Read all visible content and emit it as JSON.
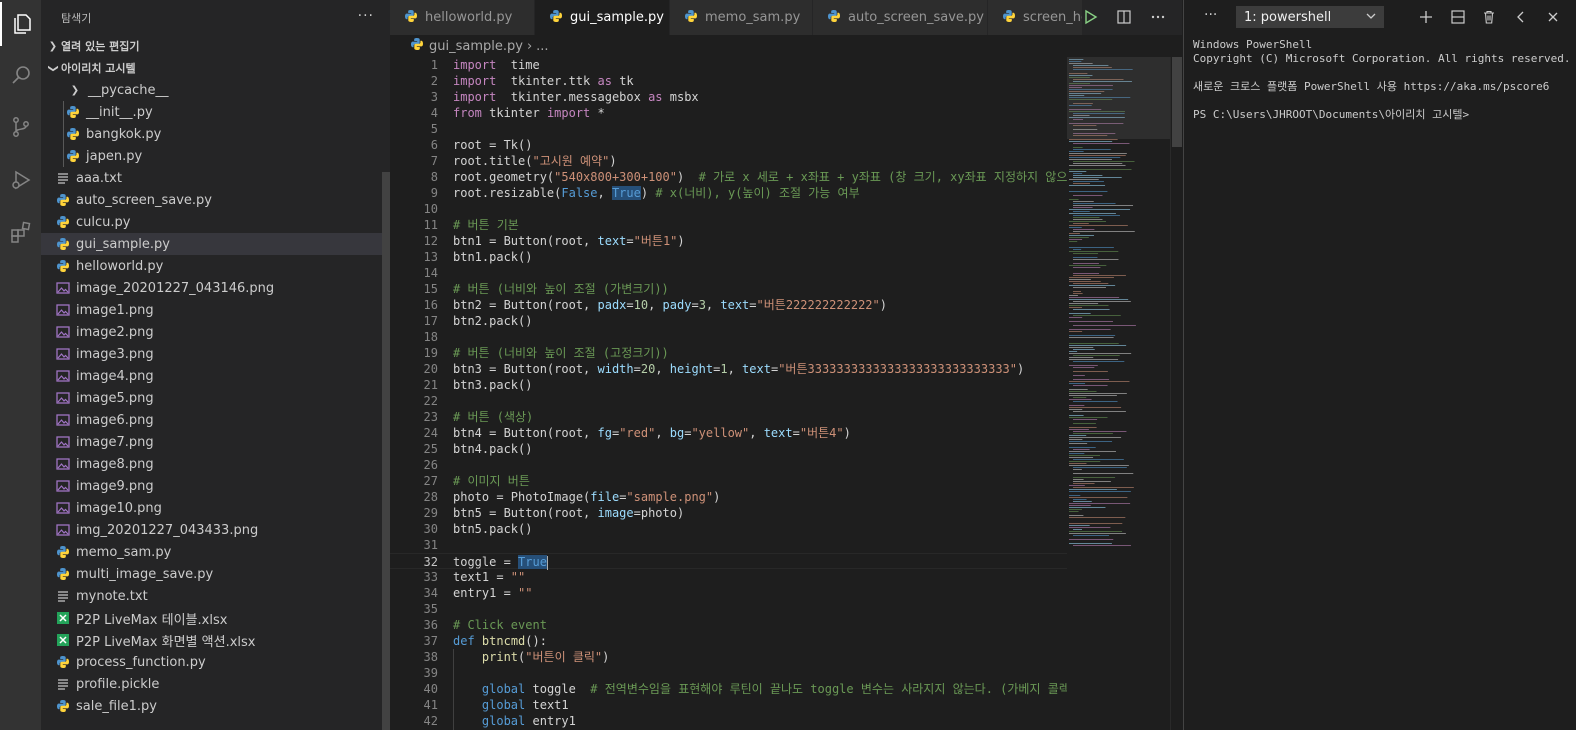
{
  "sidebar": {
    "title": "탐색기",
    "more": "···",
    "open_editors": "열려 있는 편집기",
    "folder": "아이리치 고시텔",
    "items": [
      {
        "label": "__pycache__",
        "type": "folder"
      },
      {
        "label": "__init__.py",
        "type": "py"
      },
      {
        "label": "bangkok.py",
        "type": "py"
      },
      {
        "label": "japen.py",
        "type": "py"
      },
      {
        "label": "aaa.txt",
        "type": "txt"
      },
      {
        "label": "auto_screen_save.py",
        "type": "py"
      },
      {
        "label": "culcu.py",
        "type": "py"
      },
      {
        "label": "gui_sample.py",
        "type": "py",
        "selected": true
      },
      {
        "label": "helloworld.py",
        "type": "py"
      },
      {
        "label": "image_20201227_043146.png",
        "type": "png"
      },
      {
        "label": "image1.png",
        "type": "png"
      },
      {
        "label": "image2.png",
        "type": "png"
      },
      {
        "label": "image3.png",
        "type": "png"
      },
      {
        "label": "image4.png",
        "type": "png"
      },
      {
        "label": "image5.png",
        "type": "png"
      },
      {
        "label": "image6.png",
        "type": "png"
      },
      {
        "label": "image7.png",
        "type": "png"
      },
      {
        "label": "image8.png",
        "type": "png"
      },
      {
        "label": "image9.png",
        "type": "png"
      },
      {
        "label": "image10.png",
        "type": "png"
      },
      {
        "label": "img_20201227_043433.png",
        "type": "png"
      },
      {
        "label": "memo_sam.py",
        "type": "py"
      },
      {
        "label": "multi_image_save.py",
        "type": "py"
      },
      {
        "label": "mynote.txt",
        "type": "txt"
      },
      {
        "label": "P2P LiveMax 테이블.xlsx",
        "type": "xlsx"
      },
      {
        "label": "P2P LiveMax 화면별 액션.xlsx",
        "type": "xlsx"
      },
      {
        "label": "process_function.py",
        "type": "py"
      },
      {
        "label": "profile.pickle",
        "type": "txt"
      },
      {
        "label": "sale_file1.py",
        "type": "py"
      }
    ]
  },
  "tabs": [
    {
      "label": "helloworld.py"
    },
    {
      "label": "gui_sample.py",
      "active": true,
      "close": "✕"
    },
    {
      "label": "memo_sam.py"
    },
    {
      "label": "auto_screen_save.py"
    },
    {
      "label": "screen_ho"
    }
  ],
  "breadcrumb": {
    "file": "gui_sample.py",
    "sep": "›",
    "more": "..."
  },
  "code": [
    [
      [
        "kw",
        "import"
      ],
      [
        "",
        "  time"
      ]
    ],
    [
      [
        "kw",
        "import"
      ],
      [
        "",
        "  tkinter.ttk "
      ],
      [
        "kw",
        "as"
      ],
      [
        "",
        " tk"
      ]
    ],
    [
      [
        "kw",
        "import"
      ],
      [
        "",
        "  tkinter.messagebox "
      ],
      [
        "kw",
        "as"
      ],
      [
        "",
        " msbx"
      ]
    ],
    [
      [
        "kw",
        "from"
      ],
      [
        "",
        " tkinter "
      ],
      [
        "kw",
        "import"
      ],
      [
        "",
        " *"
      ]
    ],
    [],
    [
      [
        "",
        "root = Tk()"
      ]
    ],
    [
      [
        "",
        "root.title("
      ],
      [
        "str",
        "\"고시원 예약\""
      ],
      [
        "",
        ")"
      ]
    ],
    [
      [
        "",
        "root.geometry("
      ],
      [
        "str",
        "\"540x800+300+100\""
      ],
      [
        "",
        ")  "
      ],
      [
        "cmt",
        "# 가로 x 세로 + x좌표 + y좌표 (창 크기, xy좌표 지정하지 않으면"
      ]
    ],
    [
      [
        "",
        "root.resizable("
      ],
      [
        "kw2",
        "False"
      ],
      [
        "",
        ", "
      ],
      [
        "kw2hl",
        "True"
      ],
      [
        "",
        ") "
      ],
      [
        "cmt",
        "# x(너비), y(높이) 조절 가능 여부"
      ]
    ],
    [],
    [
      [
        "cmt",
        "# 버튼 기본"
      ]
    ],
    [
      [
        "",
        "btn1 = Button(root, "
      ],
      [
        "par",
        "text"
      ],
      [
        "",
        "="
      ],
      [
        "str",
        "\"버튼1\""
      ],
      [
        "",
        ")"
      ]
    ],
    [
      [
        "",
        "btn1.pack()"
      ]
    ],
    [],
    [
      [
        "cmt",
        "# 버튼 (너비와 높이 조절 (가변크기))"
      ]
    ],
    [
      [
        "",
        "btn2 = Button(root, "
      ],
      [
        "par",
        "padx"
      ],
      [
        "",
        "="
      ],
      [
        "num",
        "10"
      ],
      [
        "",
        ", "
      ],
      [
        "par",
        "pady"
      ],
      [
        "",
        "="
      ],
      [
        "num",
        "3"
      ],
      [
        "",
        ", "
      ],
      [
        "par",
        "text"
      ],
      [
        "",
        "="
      ],
      [
        "str",
        "\"버튼222222222222\""
      ],
      [
        "",
        ")"
      ]
    ],
    [
      [
        "",
        "btn2.pack()"
      ]
    ],
    [],
    [
      [
        "cmt",
        "# 버튼 (너비와 높이 조절 (고정크기))"
      ]
    ],
    [
      [
        "",
        "btn3 = Button(root, "
      ],
      [
        "par",
        "width"
      ],
      [
        "",
        "="
      ],
      [
        "num",
        "20"
      ],
      [
        "",
        ", "
      ],
      [
        "par",
        "height"
      ],
      [
        "",
        "="
      ],
      [
        "num",
        "1"
      ],
      [
        "",
        ", "
      ],
      [
        "par",
        "text"
      ],
      [
        "",
        "="
      ],
      [
        "str",
        "\"버튼3333333333333333333333333333\""
      ],
      [
        "",
        ")"
      ]
    ],
    [
      [
        "",
        "btn3.pack()"
      ]
    ],
    [],
    [
      [
        "cmt",
        "# 버튼 (색상)"
      ]
    ],
    [
      [
        "",
        "btn4 = Button(root, "
      ],
      [
        "par",
        "fg"
      ],
      [
        "",
        "="
      ],
      [
        "str",
        "\"red\""
      ],
      [
        "",
        ", "
      ],
      [
        "par",
        "bg"
      ],
      [
        "",
        "="
      ],
      [
        "str",
        "\"yellow\""
      ],
      [
        "",
        ", "
      ],
      [
        "par",
        "text"
      ],
      [
        "",
        "="
      ],
      [
        "str",
        "\"버튼4\""
      ],
      [
        "",
        ")"
      ]
    ],
    [
      [
        "",
        "btn4.pack()"
      ]
    ],
    [],
    [
      [
        "cmt",
        "# 이미지 버튼"
      ]
    ],
    [
      [
        "",
        "photo = PhotoImage("
      ],
      [
        "par",
        "file"
      ],
      [
        "",
        "="
      ],
      [
        "str",
        "\"sample.png\""
      ],
      [
        "",
        ")"
      ]
    ],
    [
      [
        "",
        "btn5 = Button(root, "
      ],
      [
        "par",
        "image"
      ],
      [
        "",
        "=photo)"
      ]
    ],
    [
      [
        "",
        "btn5.pack()"
      ]
    ],
    [],
    [
      [
        "",
        "toggle = "
      ],
      [
        "kw2hl",
        "True"
      ],
      [
        "cursor",
        ""
      ]
    ],
    [
      [
        "",
        "text1 = "
      ],
      [
        "str",
        "\"\""
      ]
    ],
    [
      [
        "",
        "entry1 = "
      ],
      [
        "str",
        "\"\""
      ]
    ],
    [],
    [
      [
        "cmt",
        "# Click event"
      ]
    ],
    [
      [
        "kw2",
        "def"
      ],
      [
        "",
        " "
      ],
      [
        "fn",
        "btncmd"
      ],
      [
        "",
        "():"
      ]
    ],
    [
      [
        "",
        "    "
      ],
      [
        "fn",
        "print"
      ],
      [
        "",
        "("
      ],
      [
        "str",
        "\"버튼이 클릭\""
      ],
      [
        "",
        ")"
      ]
    ],
    [],
    [
      [
        "",
        "    "
      ],
      [
        "kw2",
        "global"
      ],
      [
        "",
        " toggle  "
      ],
      [
        "cmt",
        "# 전역변수임을 표현해야 루틴이 끝나도 toggle 변수는 사라지지 않는다. (가베지 콜렉"
      ]
    ],
    [
      [
        "",
        "    "
      ],
      [
        "kw2",
        "global"
      ],
      [
        "",
        " text1"
      ]
    ],
    [
      [
        "",
        "    "
      ],
      [
        "kw2",
        "global"
      ],
      [
        "",
        " entry1"
      ]
    ]
  ],
  "current_line": 32,
  "terminal": {
    "select": "1: powershell",
    "more": "···",
    "lines": [
      "Windows PowerShell",
      "Copyright (C) Microsoft Corporation. All rights reserved.",
      "",
      "새로운 크로스 플랫폼 PowerShell 사용 https://aka.ms/pscore6",
      "",
      "PS C:\\Users\\JHROOT\\Documents\\아이리치 고시텔>"
    ]
  },
  "colors": {
    "py": "#4e94ce",
    "png": "#a074c4",
    "txt": "#c5c5c5",
    "xlsx": "#23a35a"
  },
  "icons": [
    "explorer-icon",
    "search-icon",
    "source-control-icon",
    "run-debug-icon",
    "extensions-icon"
  ]
}
